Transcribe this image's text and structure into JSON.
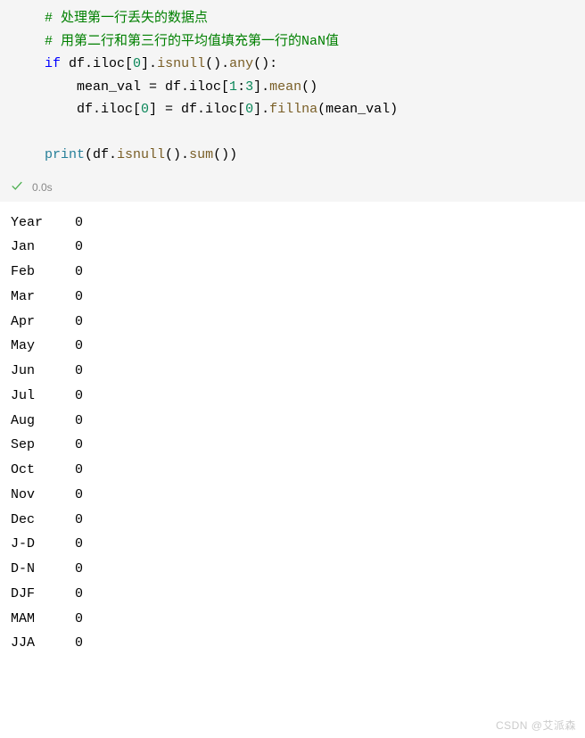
{
  "code": {
    "lines": [
      {
        "type": "comment",
        "text": "# 处理第一行丢失的数据点"
      },
      {
        "type": "comment",
        "text": "# 用第二行和第三行的平均值填充第一行的NaN值"
      },
      {
        "type": "if",
        "raw": "if df.iloc[0].isnull().any():"
      },
      {
        "type": "body1",
        "raw": "    mean_val = df.iloc[1:3].mean()"
      },
      {
        "type": "body2",
        "raw": "    df.iloc[0] = df.iloc[0].fillna(mean_val)"
      },
      {
        "type": "blank",
        "raw": ""
      },
      {
        "type": "print",
        "raw": "print(df.isnull().sum())"
      }
    ]
  },
  "status": {
    "icon": "checkmark",
    "time": "0.0s"
  },
  "output": {
    "rows": [
      {
        "label": "Year",
        "value": "0"
      },
      {
        "label": "Jan",
        "value": "0"
      },
      {
        "label": "Feb",
        "value": "0"
      },
      {
        "label": "Mar",
        "value": "0"
      },
      {
        "label": "Apr",
        "value": "0"
      },
      {
        "label": "May",
        "value": "0"
      },
      {
        "label": "Jun",
        "value": "0"
      },
      {
        "label": "Jul",
        "value": "0"
      },
      {
        "label": "Aug",
        "value": "0"
      },
      {
        "label": "Sep",
        "value": "0"
      },
      {
        "label": "Oct",
        "value": "0"
      },
      {
        "label": "Nov",
        "value": "0"
      },
      {
        "label": "Dec",
        "value": "0"
      },
      {
        "label": "J-D",
        "value": "0"
      },
      {
        "label": "D-N",
        "value": "0"
      },
      {
        "label": "DJF",
        "value": "0"
      },
      {
        "label": "MAM",
        "value": "0"
      },
      {
        "label": "JJA",
        "value": "0"
      }
    ]
  },
  "watermark": "CSDN @艾派森"
}
